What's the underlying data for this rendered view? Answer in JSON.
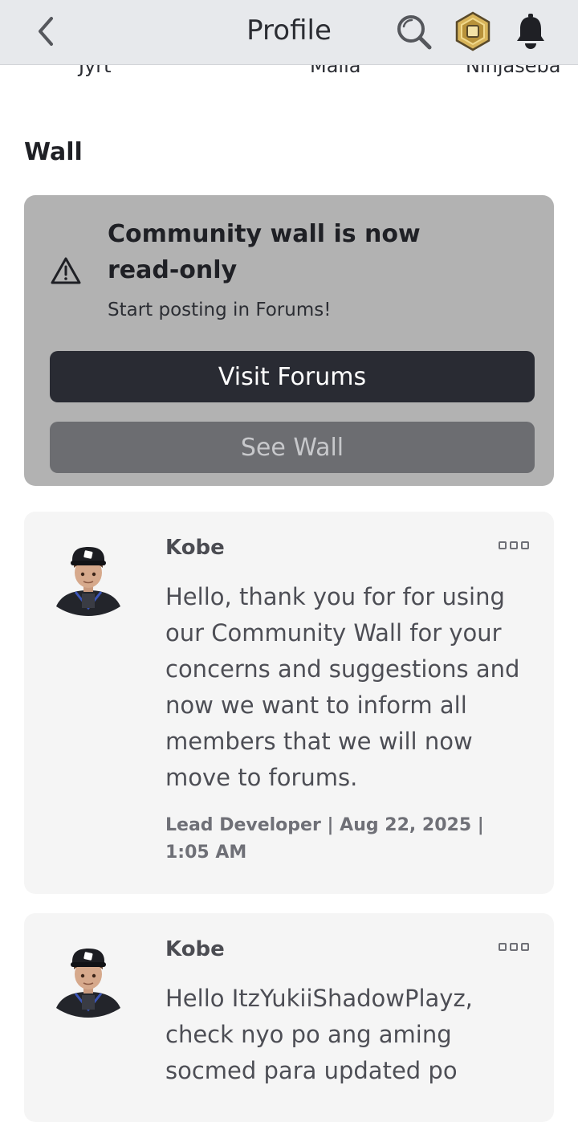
{
  "header": {
    "title": "Profile",
    "icons": {
      "back": "chevron-left-icon",
      "search": "search-icon",
      "currency": "robux-icon",
      "notifications": "bell-icon"
    }
  },
  "friends_row": {
    "names": [
      "Jyrt",
      "Malia",
      "Ninjaseba"
    ]
  },
  "wall": {
    "heading": "Wall",
    "notice": {
      "title": "Community wall is now read-only",
      "subtitle": "Start posting in Forums!",
      "primary_button": "Visit Forums",
      "secondary_button": "See Wall",
      "icon": "warning-icon"
    },
    "posts": [
      {
        "author": "Kobe",
        "body": "Hello, thank you for for using our Community Wall for your concerns and suggestions and now we want to inform all members that we will now move to forums.",
        "meta": "Lead Developer | Aug 22, 2025 | 1:05 AM"
      },
      {
        "author": "Kobe",
        "body": "Hello ItzYukiiShadowPlayz, check nyo po ang aming socmed para updated po"
      }
    ]
  },
  "colors": {
    "topbar_bg": "#e7e9ec",
    "notice_bg": "#b2b2b2",
    "primary_button_bg": "#292b33",
    "secondary_button_bg": "#6c6d71",
    "post_bg": "#f5f5f5"
  }
}
